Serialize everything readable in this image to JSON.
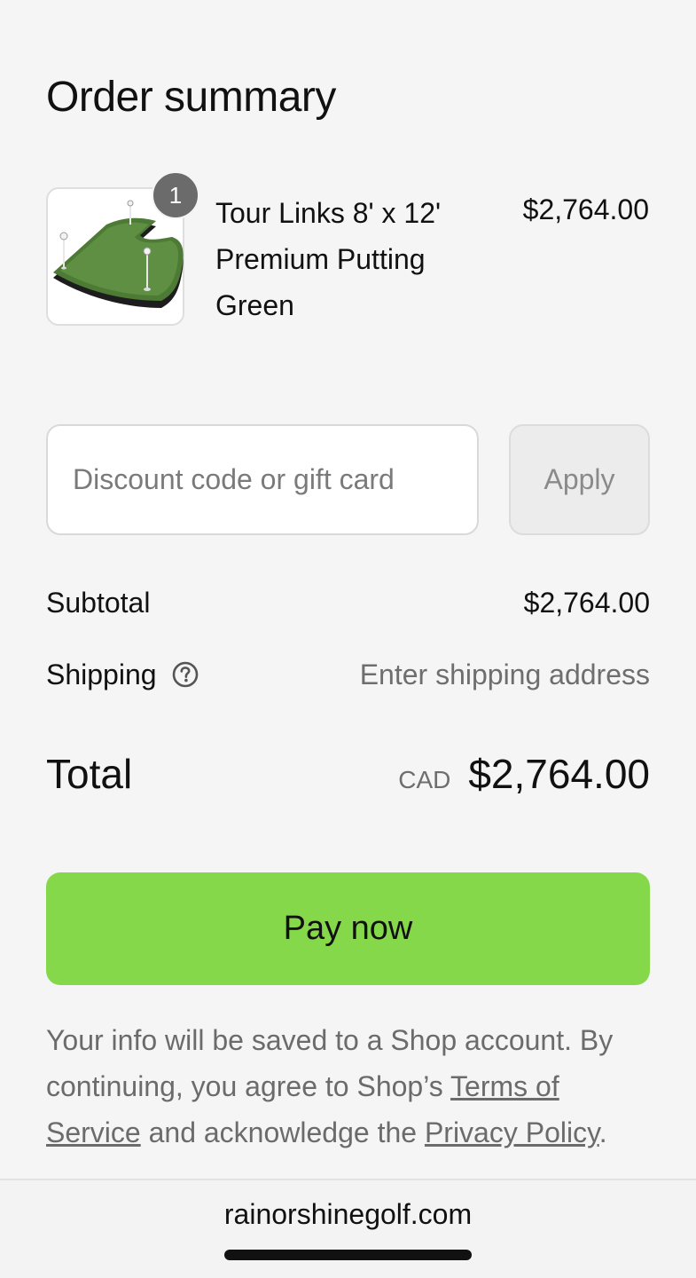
{
  "header": {
    "title": "Order summary"
  },
  "cart_item": {
    "quantity": "1",
    "name": "Tour Links 8' x 12' Premium Putting Green",
    "price": "$2,764.00",
    "image_icon": "putting-green-product-image"
  },
  "discount": {
    "placeholder": "Discount code or gift card",
    "apply_label": "Apply"
  },
  "summary": {
    "subtotal_label": "Subtotal",
    "subtotal_value": "$2,764.00",
    "shipping_label": "Shipping",
    "shipping_value": "Enter shipping address",
    "shipping_help_icon": "question-circle-icon",
    "total_label": "Total",
    "currency": "CAD",
    "total_value": "$2,764.00"
  },
  "pay": {
    "label": "Pay now",
    "color": "#86d84b"
  },
  "legal": {
    "text_1": "Your info will be saved to a Shop account. By continuing, you agree to Shop’s ",
    "terms_link": "Terms of Service",
    "text_2": " and acknowledge the ",
    "privacy_link": "Privacy Policy",
    "text_3": "."
  },
  "browser": {
    "domain": "rainorshinegolf.com"
  }
}
